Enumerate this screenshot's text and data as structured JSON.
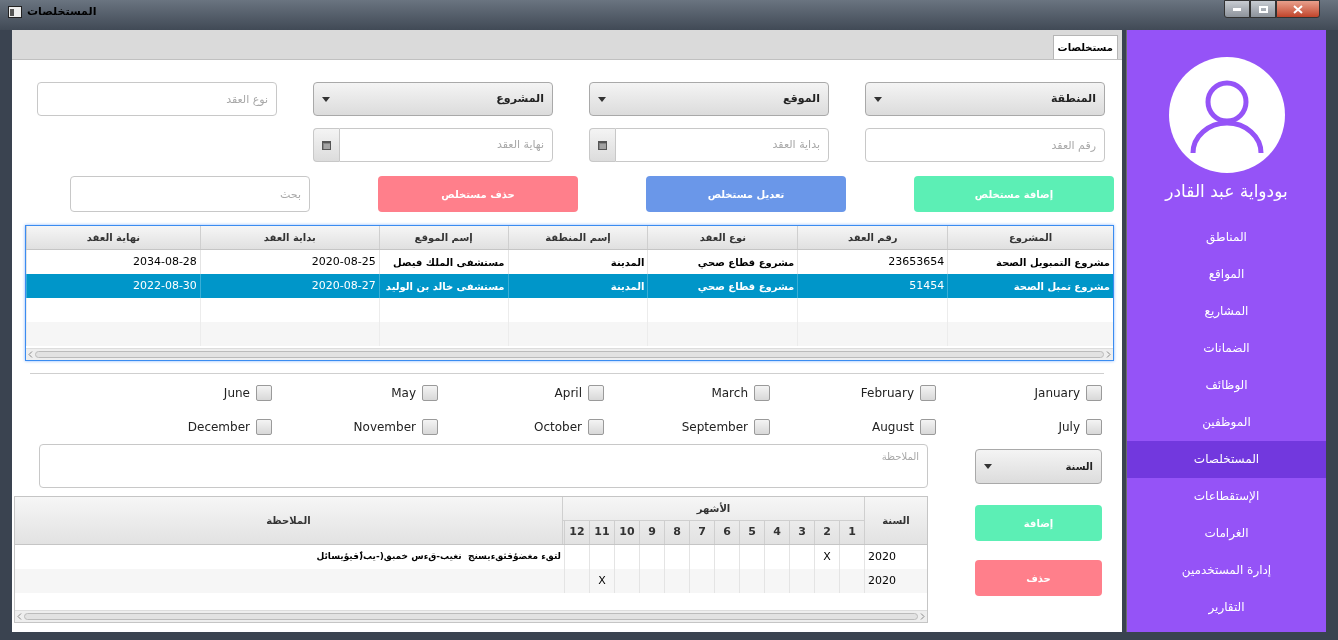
{
  "window": {
    "title": "المستخلصات"
  },
  "tabs": [
    {
      "label": "مستخلصات",
      "selected": true
    }
  ],
  "form_rows": [
    [
      {
        "kind": "combo",
        "label": "المنطقة"
      },
      {
        "kind": "combo",
        "label": "الموقع"
      },
      {
        "kind": "combo",
        "label": "المشروع"
      },
      {
        "kind": "text",
        "placeholder": "نوع العقد"
      }
    ],
    [
      {
        "kind": "text",
        "placeholder": "رقم العقد"
      },
      {
        "kind": "date",
        "placeholder": "بداية العقد"
      },
      {
        "kind": "date",
        "placeholder": "نهاية العقد"
      }
    ]
  ],
  "actions": [
    {
      "kind": "add",
      "label": "إضافة مستخلص"
    },
    {
      "kind": "edit",
      "label": "تعديل مستخلص"
    },
    {
      "kind": "delete",
      "label": "حذف مستخلص"
    }
  ],
  "search": {
    "placeholder": "بحث"
  },
  "contracts_table": {
    "columns": [
      "المشروع",
      "رقم العقد",
      "نوع العقد",
      "إسم المنطقة",
      "إسم الموقع",
      "بداية العقد",
      "نهاية العقد"
    ],
    "rows": [
      {
        "selected": false,
        "cells": [
          "مشروع التمبويل الصحة",
          "23653654",
          "مشروع قطاع صحي",
          "المدينة",
          "مستشفى الملك فيصل",
          "2020-08-25",
          "2034-08-28"
        ]
      },
      {
        "selected": true,
        "cells": [
          "مشروع تمبل الصحة",
          "51454",
          "مشروع قطاع صحي",
          "المدينة",
          "مستشفى خالد بن الوليد",
          "2020-08-27",
          "2022-08-30"
        ]
      }
    ]
  },
  "months": [
    {
      "label": "January",
      "checked": false
    },
    {
      "label": "February",
      "checked": false
    },
    {
      "label": "March",
      "checked": false
    },
    {
      "label": "April",
      "checked": false
    },
    {
      "label": "May",
      "checked": false
    },
    {
      "label": "June",
      "checked": false
    },
    {
      "label": "July",
      "checked": false
    },
    {
      "label": "August",
      "checked": false
    },
    {
      "label": "September",
      "checked": false
    },
    {
      "label": "October",
      "checked": false
    },
    {
      "label": "November",
      "checked": false
    },
    {
      "label": "December",
      "checked": false
    }
  ],
  "note_field": {
    "placeholder": "الملاحظة"
  },
  "year_combo": {
    "label": "السنة"
  },
  "payments_table": {
    "year_header": "السنة",
    "months_header": "الأشهر",
    "month_columns": [
      "1",
      "2",
      "3",
      "4",
      "5",
      "6",
      "7",
      "8",
      "9",
      "10",
      "11",
      "12"
    ],
    "note_header": "الملاحظة",
    "rows": [
      {
        "year": "2020",
        "mark": "X",
        "months": [
          {
            "checked": false
          },
          {
            "checked": true
          },
          {
            "checked": false
          },
          {
            "checked": false
          },
          {
            "checked": false
          },
          {
            "checked": false
          },
          {
            "checked": false
          },
          {
            "checked": false
          },
          {
            "checked": false
          },
          {
            "checked": false
          },
          {
            "checked": false
          },
          {
            "checked": false
          }
        ],
        "note": "لتقء مغضؤقثقءيسنج  نغيب-قءس خمبق(-يب(ٌقيؤيسائل"
      },
      {
        "year": "2020",
        "mark": "X",
        "months": [
          {
            "checked": false
          },
          {
            "checked": false
          },
          {
            "checked": false
          },
          {
            "checked": false
          },
          {
            "checked": false
          },
          {
            "checked": false
          },
          {
            "checked": false
          },
          {
            "checked": false
          },
          {
            "checked": false
          },
          {
            "checked": false
          },
          {
            "checked": true
          },
          {
            "checked": false
          }
        ]
      }
    ]
  },
  "side_buttons": [
    {
      "kind": "add",
      "label": "إضافة"
    },
    {
      "kind": "delete",
      "label": "حذف"
    }
  ],
  "sidebar": {
    "user_name": "بودواية عبد القادر",
    "items": [
      {
        "label": "المناطق",
        "selected": false
      },
      {
        "label": "المواقع",
        "selected": false
      },
      {
        "label": "المشاريع",
        "selected": false
      },
      {
        "label": "الضمانات",
        "selected": false
      },
      {
        "label": "الوظائف",
        "selected": false
      },
      {
        "label": "الموظفين",
        "selected": false
      },
      {
        "label": "المستخلصات",
        "selected": true
      },
      {
        "label": "الإستقطاعات",
        "selected": false
      },
      {
        "label": "الغرامات",
        "selected": false
      },
      {
        "label": "إدارة المستخدمين",
        "selected": false
      },
      {
        "label": "التقارير",
        "selected": false
      }
    ]
  }
}
